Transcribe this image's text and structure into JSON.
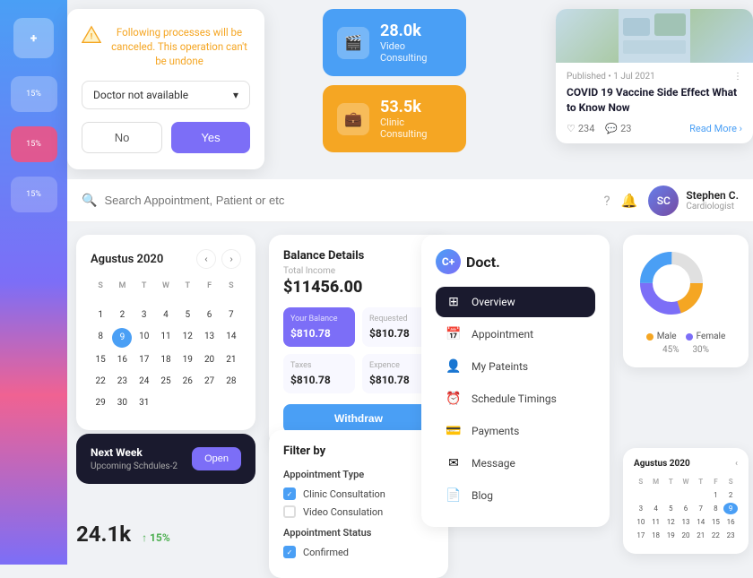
{
  "leftSidebar": {
    "items": [
      {
        "label": "15%",
        "active": false
      },
      {
        "label": "15%",
        "active": false
      },
      {
        "label": "15%",
        "active": false
      }
    ]
  },
  "cancelDialog": {
    "warningText": "Following processes will be canceled. This operation can't be undone",
    "dropdownLabel": "Doctor not available",
    "noBtnLabel": "No",
    "yesBtnLabel": "Yes"
  },
  "statsCards": {
    "videoCard": {
      "value": "28.0k",
      "label": "Video Consulting"
    },
    "clinicCard": {
      "value": "53.5k",
      "label": "Clinic Consulting"
    }
  },
  "articleCard": {
    "meta": "Published • 1 Jul 2021",
    "title": "COVID 19 Vaccine Side Effect What to Know Now",
    "likes": "234",
    "comments": "23",
    "readMore": "Read More"
  },
  "searchBar": {
    "placeholder": "Search Appointment, Patient or etc",
    "userName": "Stephen C.",
    "userRole": "Cardiologist"
  },
  "calendar": {
    "title": "Agustus 2020",
    "daysOfWeek": [
      "S",
      "M",
      "T",
      "W",
      "T",
      "F",
      "S"
    ],
    "weeks": [
      [
        "",
        "",
        "",
        "",
        "",
        "",
        ""
      ],
      [
        "1",
        "2",
        "3",
        "4",
        "5",
        "6",
        "7"
      ],
      [
        "8",
        "9",
        "10",
        "11",
        "12",
        "13",
        "14"
      ],
      [
        "15",
        "16",
        "17",
        "18",
        "19",
        "20",
        "21"
      ],
      [
        "22",
        "23",
        "24",
        "25",
        "26",
        "27",
        "28"
      ],
      [
        "29",
        "30",
        "31",
        "",
        "",
        "",
        ""
      ]
    ],
    "today": "9"
  },
  "nextWeek": {
    "title": "Next Week",
    "subtitle": "Upcoming Schdules-2",
    "buttonLabel": "Open"
  },
  "bottomStat": {
    "value": "24.1k",
    "pct": "↑ 15%"
  },
  "balanceCard": {
    "title": "Balance Details",
    "totalLabel": "Total Income",
    "totalValue": "$11456.00",
    "items": [
      {
        "label": "Your Balance",
        "value": "$810.78",
        "purple": true
      },
      {
        "label": "Requested",
        "value": "$810.78",
        "purple": false
      },
      {
        "label": "Taxes",
        "value": "$810.78",
        "purple": false
      },
      {
        "label": "Expence",
        "value": "$810.78",
        "purple": false
      }
    ],
    "withdrawLabel": "Withdraw"
  },
  "filterCard": {
    "title": "Filter by",
    "appointmentTypeLabel": "Appointment Type",
    "types": [
      {
        "label": "Clinic Consultation",
        "checked": true
      },
      {
        "label": "Video Consulation",
        "checked": false
      }
    ],
    "statusLabel": "Appointment Status",
    "statuses": [
      {
        "label": "Confirmed",
        "checked": true
      }
    ]
  },
  "doctNav": {
    "logo": "Doct.",
    "items": [
      {
        "icon": "⊞",
        "label": "Overview",
        "active": true
      },
      {
        "icon": "📅",
        "label": "Appointment",
        "active": false
      },
      {
        "icon": "👤",
        "label": "My Pateints",
        "active": false
      },
      {
        "icon": "⏰",
        "label": "Schedule Timings",
        "active": false
      },
      {
        "icon": "💳",
        "label": "Payments",
        "active": false
      },
      {
        "icon": "✉",
        "label": "Message",
        "active": false
      },
      {
        "icon": "📄",
        "label": "Blog",
        "active": false
      }
    ]
  },
  "chartCard": {
    "title": "",
    "malePct": "45%",
    "femalePct": "30%",
    "maleColor": "#f5a623",
    "femaleColor": "#7c6ef7",
    "neutralColor": "#4a9ff5",
    "maleLabel": "Male",
    "femaleLabel": "Female"
  },
  "miniCalendar": {
    "title": "Agustus 2020",
    "daysOfWeek": [
      "S",
      "M",
      "T",
      "W",
      "T",
      "F",
      "S"
    ],
    "weeks": [
      [
        "",
        "",
        "",
        "",
        "",
        "",
        ""
      ],
      [
        "1",
        "2",
        "3",
        "4",
        "5",
        "6"
      ],
      [
        "8",
        "9",
        "10",
        "11",
        "12",
        "13"
      ],
      [
        "15",
        "16",
        "17",
        "18",
        "19",
        "20"
      ]
    ],
    "today": "9"
  }
}
